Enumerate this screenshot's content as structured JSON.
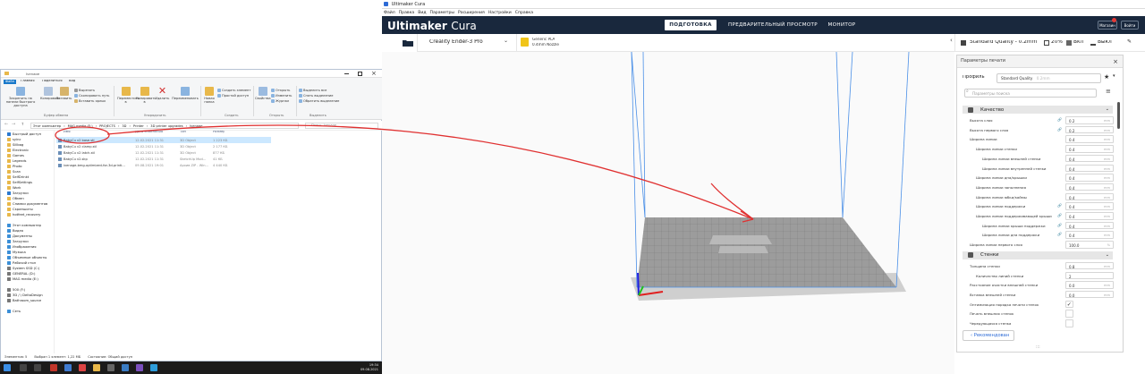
{
  "explorer": {
    "title": "Ivenage",
    "tabs": [
      "Файл",
      "Главная",
      "Поделиться",
      "Вид"
    ],
    "ribbon": {
      "pin": "Закрепить на панели быстрого доступа",
      "copy": "Копировать",
      "paste": "Вставить",
      "cut": "Вырезать",
      "copy_path": "Скопировать путь",
      "paste_shortcut": "Вставить ярлык",
      "move": "Переместить в",
      "copy_to": "Копировать в",
      "delete": "Удалить",
      "rename": "Переименовать",
      "new_folder": "Новая папка",
      "new_item": "Создать элемент",
      "easy_access": "Простой доступ",
      "properties": "Свойства",
      "open": "Открыть",
      "edit": "Изменить",
      "history": "Журнал",
      "select_all": "Выделить все",
      "select_none": "Снять выделение",
      "invert": "Обратить выделение",
      "groups": [
        "Буфер обмена",
        "Упорядочить",
        "Создать",
        "Открыть",
        "Выделить"
      ]
    },
    "address": [
      "Этот компьютер",
      "MAG media (E:)",
      "PROJECTS",
      "3D",
      "Printer",
      "3D printer upgrades",
      "Ivenage"
    ],
    "search_placeholder": "Поиск: Ivenage",
    "nav": [
      {
        "label": "Быстрый доступ",
        "color": "#2b79d0"
      },
      {
        "label": "syinc",
        "color": "#e8b84a"
      },
      {
        "label": "Sillbag",
        "color": "#e8b84a"
      },
      {
        "label": "Electronic",
        "color": "#e8b84a"
      },
      {
        "label": "Games",
        "color": "#e8b84a"
      },
      {
        "label": "Legends",
        "color": "#e8b84a"
      },
      {
        "label": "Photo",
        "color": "#e8b84a"
      },
      {
        "label": "Scan",
        "color": "#e8b84a"
      },
      {
        "label": "SelfDrinkt",
        "color": "#e8b84a"
      },
      {
        "label": "SelfSettings",
        "color": "#e8b84a"
      },
      {
        "label": "Work",
        "color": "#e8b84a"
      },
      {
        "label": "Загрузки",
        "color": "#2b79d0"
      },
      {
        "label": "Обмен",
        "color": "#e8b84a"
      },
      {
        "label": "Снимки документов",
        "color": "#e8b84a"
      },
      {
        "label": "Скриншоты",
        "color": "#e8b84a"
      },
      {
        "label": "hotfeet_recovery",
        "color": "#e8b84a"
      },
      {
        "label": "Этот компьютер",
        "color": "#3b8fd8"
      },
      {
        "label": "Видео",
        "color": "#3b8fd8"
      },
      {
        "label": "Документы",
        "color": "#3b8fd8"
      },
      {
        "label": "Загрузки",
        "color": "#3b8fd8"
      },
      {
        "label": "Изображения",
        "color": "#3b8fd8"
      },
      {
        "label": "Музыка",
        "color": "#3b8fd8"
      },
      {
        "label": "Объемные объекты",
        "color": "#3b8fd8"
      },
      {
        "label": "Рабочий стол",
        "color": "#3b8fd8"
      },
      {
        "label": "System SSD (C:)",
        "color": "#777"
      },
      {
        "label": "GENERAL (D:)",
        "color": "#777"
      },
      {
        "label": "MAG media (E:)",
        "color": "#777"
      },
      {
        "label": "500 (F:)",
        "color": "#777"
      },
      {
        "label": "3D / \\ DeltaDesign",
        "color": "#777"
      },
      {
        "label": "Bathroom_source",
        "color": "#777"
      },
      {
        "label": "Сеть",
        "color": "#3b8fd8"
      }
    ],
    "columns": [
      "Имя",
      "Дата изменения",
      "Тип",
      "Размер"
    ],
    "files": [
      {
        "name": "BabyCu v2 base.stl",
        "date": "12.02.2021 11:31",
        "type": "3D Object",
        "size": "1 223 КБ",
        "selected": true
      },
      {
        "name": "BabyCu v2 clamp.stl",
        "date": "12.02.2021 11:31",
        "type": "3D Object",
        "size": "2 177 КБ",
        "selected": false
      },
      {
        "name": "BabyCu v2 latch.stl",
        "date": "12.02.2021 11:31",
        "type": "3D Object",
        "size": "877 КБ",
        "selected": false
      },
      {
        "name": "BabyCu v2.skp",
        "date": "12.02.2021 11:31",
        "type": "SketchUp Mod...",
        "size": "41 КБ",
        "selected": false
      },
      {
        "name": "ivenage-bmg-optimized-for-3d-printi...",
        "date": "09.08.2021 19:01",
        "type": "Архив ZIP - Win...",
        "size": "4 440 КБ",
        "selected": false
      }
    ],
    "status": {
      "count": "Элементов: 5",
      "selected": "Выбран 1 элемент: 1,22 МБ",
      "share": "Состояние: Общий доступ"
    },
    "clock": {
      "time": "19:34",
      "date": "09.08.2021"
    }
  },
  "cura": {
    "window_title": "Ultimaker Cura",
    "menu": [
      "Файл",
      "Правка",
      "Вид",
      "Параметры",
      "Расширения",
      "Настройки",
      "Справка"
    ],
    "logo_bold": "Ultimaker",
    "logo_light": "Cura",
    "stages": [
      "ПОДГОТОВКА",
      "ПРЕДВАРИТЕЛЬНЫЙ ПРОСМОТР",
      "МОНИТОР"
    ],
    "marketplace": "Магазин",
    "login": "Войти",
    "printer": "Creality Ender-3 Pro",
    "material": "Generic PLA",
    "nozzle": "0.4mm Nozzle",
    "quality": "Standard Quality - 0.2mm",
    "infill": "20%",
    "support": "Вкл",
    "adhesion": "Выкл",
    "panel": {
      "title": "Параметры печати",
      "profile_label": "Профиль",
      "profile_value": "Standard Quality",
      "profile_hint": "0.2mm",
      "search_placeholder": "Параметры поиска",
      "recommended": "Рекомендован",
      "categories": [
        {
          "name": "Качество",
          "items": [
            {
              "label": "Высота слоя",
              "value": "0.2",
              "unit": "mm",
              "indent": 0,
              "link": true
            },
            {
              "label": "Высота первого слоя",
              "value": "0.2",
              "unit": "mm",
              "indent": 0,
              "link": true
            },
            {
              "label": "Ширина линии",
              "value": "0.4",
              "unit": "mm",
              "indent": 0,
              "link": false
            },
            {
              "label": "Ширина линии стенки",
              "value": "0.4",
              "unit": "mm",
              "indent": 1,
              "link": false
            },
            {
              "label": "Ширина линии внешней стенки",
              "value": "0.4",
              "unit": "mm",
              "indent": 2,
              "link": false
            },
            {
              "label": "Ширина линии внутренней стенки",
              "value": "0.4",
              "unit": "mm",
              "indent": 2,
              "link": false
            },
            {
              "label": "Ширина линии дна/крышки",
              "value": "0.4",
              "unit": "mm",
              "indent": 1,
              "link": false
            },
            {
              "label": "Ширина линии заполнения",
              "value": "0.4",
              "unit": "mm",
              "indent": 1,
              "link": false
            },
            {
              "label": "Ширина линии юбки/каймы",
              "value": "0.4",
              "unit": "mm",
              "indent": 1,
              "link": false
            },
            {
              "label": "Ширина линии поддержки",
              "value": "0.4",
              "unit": "mm",
              "indent": 1,
              "link": true
            },
            {
              "label": "Ширина линии поддерживающей крыши",
              "value": "0.4",
              "unit": "mm",
              "indent": 1,
              "link": true
            },
            {
              "label": "Ширина линии крыши поддержки",
              "value": "0.4",
              "unit": "mm",
              "indent": 2,
              "link": true
            },
            {
              "label": "Ширина линии дна поддержки",
              "value": "0.4",
              "unit": "mm",
              "indent": 2,
              "link": true
            },
            {
              "label": "Ширина линии первого слоя",
              "value": "100.0",
              "unit": "%",
              "indent": 0,
              "link": false
            }
          ]
        },
        {
          "name": "Стенки",
          "items": [
            {
              "label": "Толщина стенки",
              "value": "0.8",
              "unit": "mm",
              "indent": 0,
              "link": false
            },
            {
              "label": "Количество линий стенки",
              "value": "2",
              "unit": "",
              "indent": 1,
              "link": false
            },
            {
              "label": "Расстояние очистки внешней стенки",
              "value": "0.0",
              "unit": "mm",
              "indent": 0,
              "link": false
            },
            {
              "label": "Вставка внешней стенки",
              "value": "0.0",
              "unit": "mm",
              "indent": 0,
              "link": false
            },
            {
              "label": "Оптимизация порядка печати стенок",
              "check": true
            },
            {
              "label": "Печать внешних стенок",
              "check": false
            },
            {
              "label": "Чередующаяся стенка",
              "check": false
            }
          ]
        }
      ]
    }
  },
  "colors": {
    "cura_header": "#19283d",
    "annotation": "#e03030",
    "accent": "#2d6bd6"
  }
}
